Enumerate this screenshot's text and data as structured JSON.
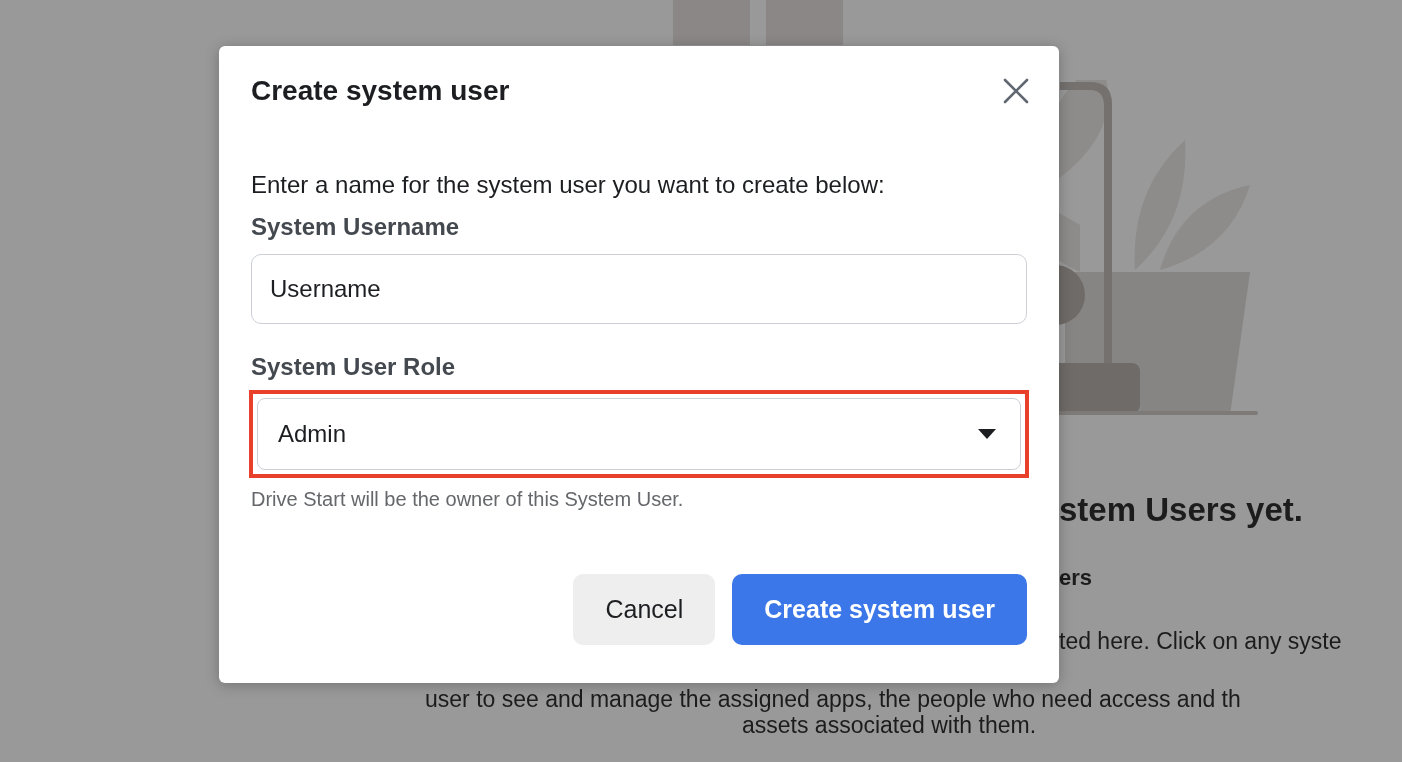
{
  "background": {
    "heading": "stem Users yet.",
    "subheading": "ers",
    "description_lines": [
      "ted here. Click on any syste",
      "user to see and manage the assigned apps, the people who need access and th",
      "assets associated with them."
    ]
  },
  "dialog": {
    "title": "Create system user",
    "intro": "Enter a name for the system user you want to create below:",
    "fields": [
      {
        "kind": "text",
        "label": "System Username",
        "value": "Username"
      },
      {
        "kind": "select",
        "label": "System User Role",
        "value": "Admin",
        "highlighted": true
      }
    ],
    "helper": "Drive Start will be the owner of this System User.",
    "buttons": [
      {
        "kind": "secondary",
        "label": "Cancel"
      },
      {
        "kind": "primary",
        "label": "Create system user"
      }
    ]
  }
}
